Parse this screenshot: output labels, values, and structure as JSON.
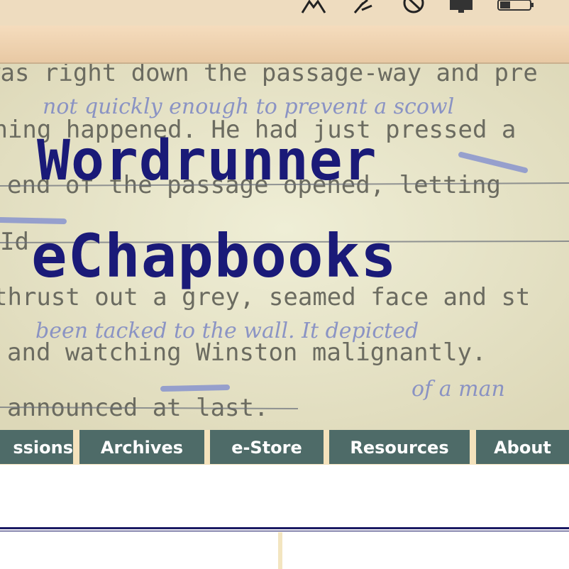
{
  "menubar": {
    "icons": [
      "antenna-icon",
      "tool-icon",
      "no-sign-icon",
      "display-icon",
      "battery-icon"
    ]
  },
  "banner": {
    "title_line1": "Wordrunner",
    "title_line2": "eChapbooks",
    "manuscript_lines": [
      "thing happened. He had just pressed a",
      "end of the passage opened, letting",
      "Id",
      "thrust out a grey, seamed face and st",
      "and watching Winston malignantly.",
      "announced at last."
    ],
    "handwriting": [
      "not quickly enough to prevent a scowl",
      "been tacked to the wall. It depicted",
      "of a man"
    ]
  },
  "nav": {
    "tabs": [
      "ssions",
      "Archives",
      "e-Store",
      "Resources",
      "About"
    ]
  },
  "colors": {
    "tab_bg": "#4e6b68",
    "nav_bg": "#f4e2bc",
    "title_ink": "#1a1a78",
    "rule": "#1b1a64"
  }
}
